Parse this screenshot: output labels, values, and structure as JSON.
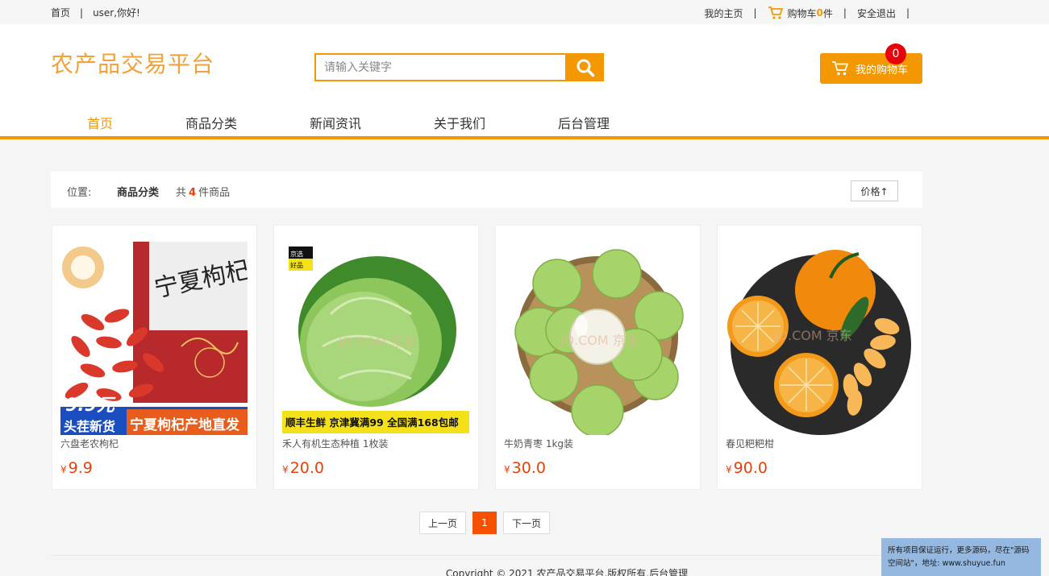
{
  "topbar": {
    "home": "首页",
    "greeting": "user,你好!",
    "my_home": "我的主页",
    "cart_prefix": "购物车",
    "cart_count": "0",
    "cart_suffix": "件",
    "logout": "安全退出"
  },
  "header": {
    "logo": "农产品交易平台",
    "search_placeholder": "请输入关键字",
    "cart_button": "我的购物车",
    "cart_badge": "0"
  },
  "nav": {
    "items": [
      {
        "label": "首页",
        "active": true
      },
      {
        "label": "商品分类",
        "active": false
      },
      {
        "label": "新闻资讯",
        "active": false
      },
      {
        "label": "关于我们",
        "active": false
      },
      {
        "label": "后台管理",
        "active": false
      }
    ]
  },
  "filter": {
    "position_label": "位置:",
    "category": "商品分类",
    "count_prefix": "共",
    "count": "4",
    "count_suffix": "件商品",
    "sort_label": "价格↑"
  },
  "products": [
    {
      "name": "六盘老农枸杞",
      "currency": "¥",
      "price": "9.9",
      "image": "goji-berry-package"
    },
    {
      "name": "禾人有机生态种植 1枚装",
      "currency": "¥",
      "price": "20.0",
      "image": "cabbage"
    },
    {
      "name": "牛奶青枣 1kg装",
      "currency": "¥",
      "price": "30.0",
      "image": "green-jujube"
    },
    {
      "name": "春见粑粑柑",
      "currency": "¥",
      "price": "90.0",
      "image": "mandarin-orange"
    }
  ],
  "product_image_text": {
    "goji_title": "宁夏枸杞",
    "goji_price": "9.9元",
    "goji_new": "头茬新货",
    "goji_banner": "宁夏枸杞产地直发",
    "cabbage_tag": "京选好品",
    "cabbage_banner": "顺丰生鲜 京津冀满99 全国满168包邮",
    "watermark": "JD.COM 京东"
  },
  "pager": {
    "prev": "上一页",
    "current": "1",
    "next": "下一页"
  },
  "footer": {
    "copyright": "Copyright © 2021 农产品交易平台,版权所有,后台管理"
  },
  "notice": {
    "text": "所有项目保证运行，更多源码，尽在\"源码空间站\"，地址: www.shuyue.fun"
  },
  "colors": {
    "accent": "#f39800",
    "logo": "#f1a23c",
    "price": "#e8410b",
    "badge": "#e8000b",
    "pager_current": "#f75000"
  }
}
